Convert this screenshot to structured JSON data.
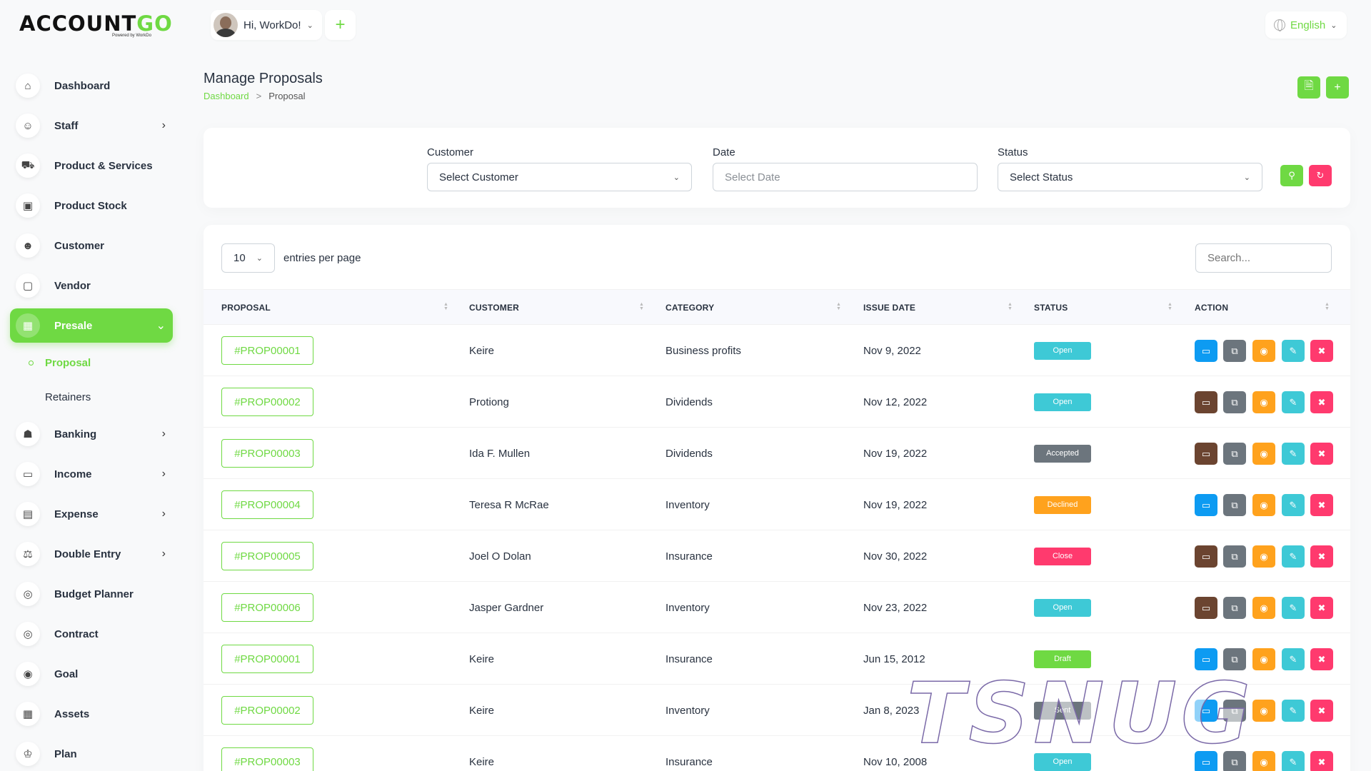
{
  "brand": {
    "name_a": "ACCOUNT",
    "name_b": "GO",
    "tagline": "Powered by WorkDo"
  },
  "topbar": {
    "greeting": "Hi, WorkDo!",
    "language": "English"
  },
  "sidebar": {
    "items": [
      {
        "label": "Dashboard",
        "icon": "home-icon",
        "arrow": false
      },
      {
        "label": "Staff",
        "icon": "users-icon",
        "arrow": true
      },
      {
        "label": "Product & Services",
        "icon": "cart-icon",
        "arrow": false
      },
      {
        "label": "Product Stock",
        "icon": "box-icon",
        "arrow": false
      },
      {
        "label": "Customer",
        "icon": "user-plus-icon",
        "arrow": false
      },
      {
        "label": "Vendor",
        "icon": "note-icon",
        "arrow": false
      },
      {
        "label": "Presale",
        "icon": "calendar-icon",
        "arrow": true,
        "active": true
      },
      {
        "label": "Banking",
        "icon": "bank-icon",
        "arrow": true
      },
      {
        "label": "Income",
        "icon": "file-icon",
        "arrow": true
      },
      {
        "label": "Expense",
        "icon": "clipboard-icon",
        "arrow": true
      },
      {
        "label": "Double Entry",
        "icon": "scale-icon",
        "arrow": true
      },
      {
        "label": "Budget Planner",
        "icon": "coins-icon",
        "arrow": false
      },
      {
        "label": "Contract",
        "icon": "coins-icon",
        "arrow": false
      },
      {
        "label": "Goal",
        "icon": "target-icon",
        "arrow": false
      },
      {
        "label": "Assets",
        "icon": "calculator-icon",
        "arrow": false
      },
      {
        "label": "Plan",
        "icon": "trophy-icon",
        "arrow": false
      }
    ],
    "sub_items": [
      {
        "label": "Proposal",
        "active": true
      },
      {
        "label": "Retainers",
        "active": false
      }
    ]
  },
  "page": {
    "title": "Manage Proposals",
    "breadcrumb": {
      "home": "Dashboard",
      "separator": ">",
      "current": "Proposal"
    }
  },
  "filters": {
    "customer": {
      "label": "Customer",
      "value": "Select Customer"
    },
    "date": {
      "label": "Date",
      "placeholder": "Select Date"
    },
    "status": {
      "label": "Status",
      "value": "Select Status"
    }
  },
  "table": {
    "entries_value": "10",
    "entries_label": "entries per page",
    "search_placeholder": "Search...",
    "columns": [
      "PROPOSAL",
      "CUSTOMER",
      "CATEGORY",
      "ISSUE DATE",
      "STATUS",
      "ACTION"
    ],
    "rows": [
      {
        "proposal": "#PROP00001",
        "customer": "Keire",
        "category": "Business profits",
        "issue_date": "Nov 9, 2022",
        "status": "Open",
        "first_action": "blue"
      },
      {
        "proposal": "#PROP00002",
        "customer": "Protiong",
        "category": "Dividends",
        "issue_date": "Nov 12, 2022",
        "status": "Open",
        "first_action": "brown"
      },
      {
        "proposal": "#PROP00003",
        "customer": "Ida F. Mullen",
        "category": "Dividends",
        "issue_date": "Nov 19, 2022",
        "status": "Accepted",
        "first_action": "brown"
      },
      {
        "proposal": "#PROP00004",
        "customer": "Teresa R McRae",
        "category": "Inventory",
        "issue_date": "Nov 19, 2022",
        "status": "Declined",
        "first_action": "blue"
      },
      {
        "proposal": "#PROP00005",
        "customer": "Joel O Dolan",
        "category": "Insurance",
        "issue_date": "Nov 30, 2022",
        "status": "Close",
        "first_action": "brown"
      },
      {
        "proposal": "#PROP00006",
        "customer": "Jasper Gardner",
        "category": "Inventory",
        "issue_date": "Nov 23, 2022",
        "status": "Open",
        "first_action": "brown"
      },
      {
        "proposal": "#PROP00001",
        "customer": "Keire",
        "category": "Insurance",
        "issue_date": "Jun 15, 2012",
        "status": "Draft",
        "first_action": "blue"
      },
      {
        "proposal": "#PROP00002",
        "customer": "Keire",
        "category": "Inventory",
        "issue_date": "Jan 8, 2023",
        "status": "Sent",
        "first_action": "blue"
      },
      {
        "proposal": "#PROP00003",
        "customer": "Keire",
        "category": "Insurance",
        "issue_date": "Nov 10, 2008",
        "status": "Open",
        "first_action": "blue"
      }
    ]
  },
  "colors": {
    "accent": "#6fd943",
    "status": {
      "Open": "#3ec9d6",
      "Accepted": "#6c757d",
      "Declined": "#ffa21d",
      "Close": "#ff3a6e",
      "Draft": "#6fd943",
      "Sent": "#6c757d"
    },
    "actions": {
      "blue": "#0d9bf2",
      "brown": "#6b4430",
      "copy": "#6c757d",
      "view": "#ffa21d",
      "edit": "#3ec9d6",
      "delete": "#ff3a6e"
    }
  },
  "watermark": "TSNUG"
}
